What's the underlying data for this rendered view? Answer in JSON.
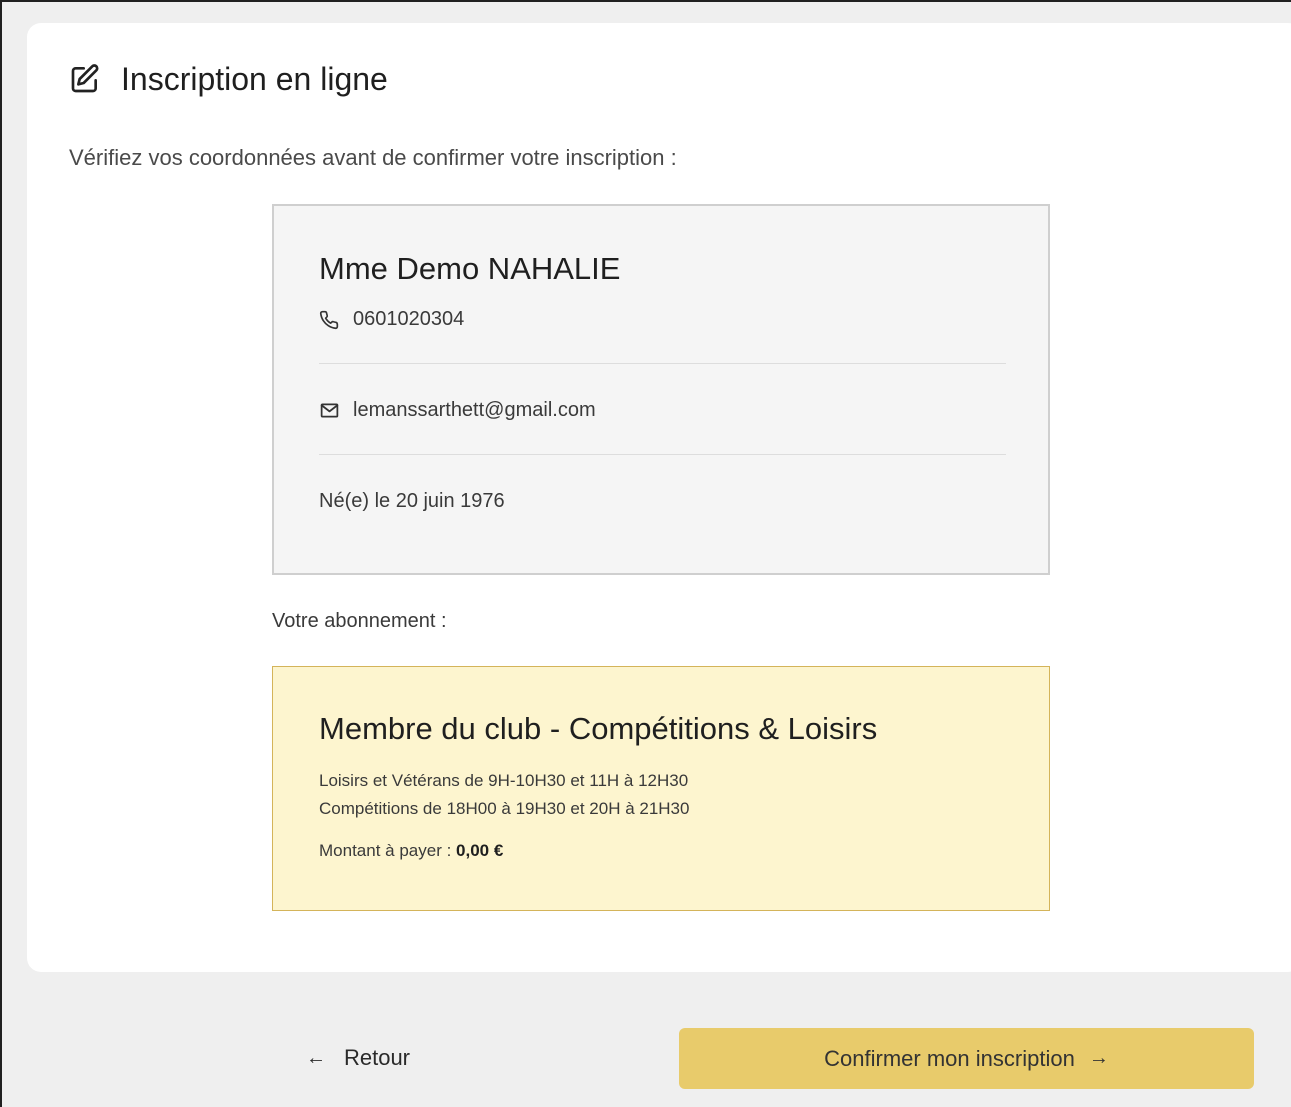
{
  "header": {
    "title": "Inscription en ligne",
    "intro": "Vérifiez vos coordonnées avant de confirmer votre inscription :"
  },
  "contact": {
    "name": "Mme Demo NAHALIE",
    "phone": "0601020304",
    "email": "lemanssarthett@gmail.com",
    "birth": "Né(e) le 20 juin 1976"
  },
  "subscription": {
    "label": "Votre abonnement :",
    "title": "Membre du club - Compétitions & Loisirs",
    "description_lines": [
      "Loisirs et Vétérans de 9H-10H30 et 11H à 12H30",
      "Compétitions de 18H00 à 19H30 et 20H à 21H30"
    ],
    "price_label": "Montant à payer : ",
    "price_value": "0,00 €"
  },
  "actions": {
    "back_label": "Retour",
    "back_arrow": "←",
    "confirm_label": "Confirmer mon inscription",
    "confirm_arrow": "→"
  },
  "colors": {
    "confirm_button": "#e8cb6b",
    "subscription_bg": "#fdf5cf",
    "subscription_border": "#d4b45a"
  },
  "icons": {
    "title": "edit-icon",
    "phone": "phone-icon",
    "email": "mail-icon"
  }
}
